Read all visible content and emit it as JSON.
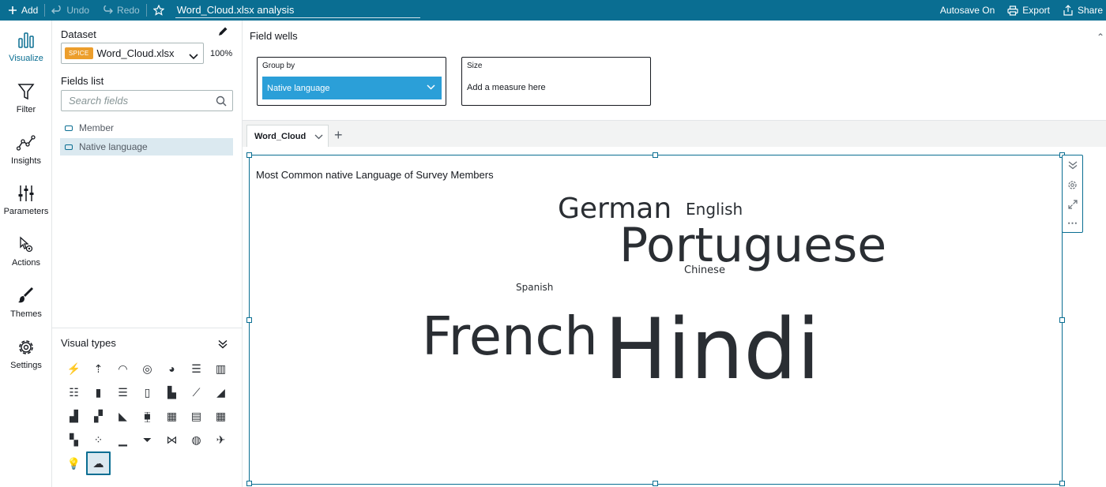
{
  "topbar": {
    "add_label": "Add",
    "undo_label": "Undo",
    "redo_label": "Redo",
    "analysis_title": "Word_Cloud.xlsx analysis",
    "autosave_label": "Autosave On",
    "export_label": "Export",
    "share_label": "Share"
  },
  "rail": {
    "items": [
      {
        "label": "Visualize",
        "icon": "bar-chart-icon"
      },
      {
        "label": "Filter",
        "icon": "funnel-icon"
      },
      {
        "label": "Insights",
        "icon": "insights-line-icon"
      },
      {
        "label": "Parameters",
        "icon": "sliders-icon"
      },
      {
        "label": "Actions",
        "icon": "pointer-gear-icon"
      },
      {
        "label": "Themes",
        "icon": "paintbrush-icon"
      },
      {
        "label": "Settings",
        "icon": "gear-icon"
      }
    ]
  },
  "dataset_panel": {
    "dataset_label": "Dataset",
    "spice_badge": "SPICE",
    "dataset_name": "Word_Cloud.xlsx",
    "spice_percent": "100%",
    "fields_list_label": "Fields list",
    "search_placeholder": "Search fields",
    "fields": [
      {
        "name": "Member",
        "selected": false
      },
      {
        "name": "Native language",
        "selected": true
      }
    ],
    "visual_types_label": "Visual types"
  },
  "field_wells": {
    "title": "Field wells",
    "group_by_label": "Group by",
    "group_by_value": "Native language",
    "size_label": "Size",
    "size_placeholder": "Add a measure here"
  },
  "sheet_tabs": [
    {
      "label": "Word_Cloud"
    }
  ],
  "visual": {
    "title": "Most Common native Language of Survey Members",
    "words": [
      {
        "text": "German"
      },
      {
        "text": "English"
      },
      {
        "text": "Portuguese"
      },
      {
        "text": "Chinese"
      },
      {
        "text": "Spanish"
      },
      {
        "text": "French"
      },
      {
        "text": "Hindi"
      }
    ]
  },
  "colors": {
    "topbar": "#0a6e92",
    "accent": "#0a6e92",
    "chip": "#2b9fd8",
    "spice": "#ec9e2c",
    "selected_field_bg": "#dbe9f0"
  }
}
